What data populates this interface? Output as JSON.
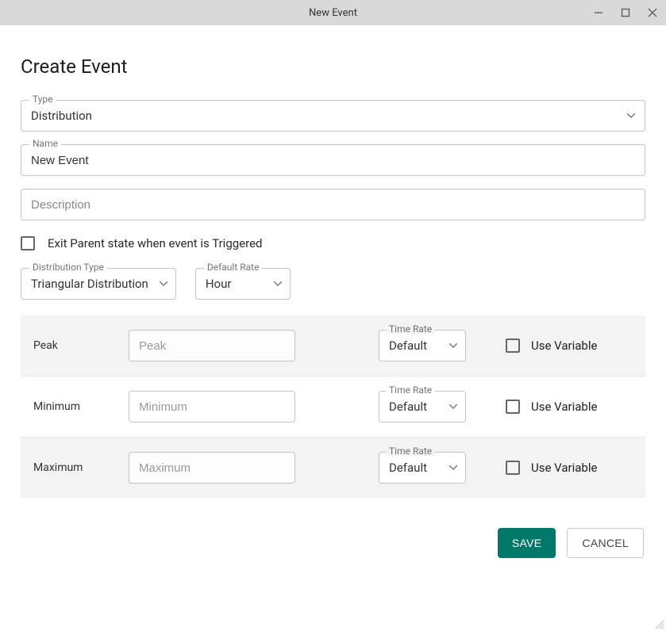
{
  "window": {
    "title": "New Event"
  },
  "header": {
    "title": "Create Event"
  },
  "form": {
    "type_label": "Type",
    "type_value": "Distribution",
    "name_label": "Name",
    "name_value": "New Event",
    "description_placeholder": "Description",
    "exit_parent_label": "Exit Parent state when event is Triggered",
    "dist_type_label": "Distribution Type",
    "dist_type_value": "Triangular Distribution",
    "default_rate_label": "Default Rate",
    "default_rate_value": "Hour"
  },
  "params": [
    {
      "label": "Peak",
      "placeholder": "Peak",
      "time_rate_label": "Time Rate",
      "time_rate_value": "Default",
      "usevar_label": "Use Variable",
      "shaded": true
    },
    {
      "label": "Minimum",
      "placeholder": "Minimum",
      "time_rate_label": "Time Rate",
      "time_rate_value": "Default",
      "usevar_label": "Use Variable",
      "shaded": false
    },
    {
      "label": "Maximum",
      "placeholder": "Maximum",
      "time_rate_label": "Time Rate",
      "time_rate_value": "Default",
      "usevar_label": "Use Variable",
      "shaded": true
    }
  ],
  "buttons": {
    "save": "SAVE",
    "cancel": "CANCEL"
  }
}
